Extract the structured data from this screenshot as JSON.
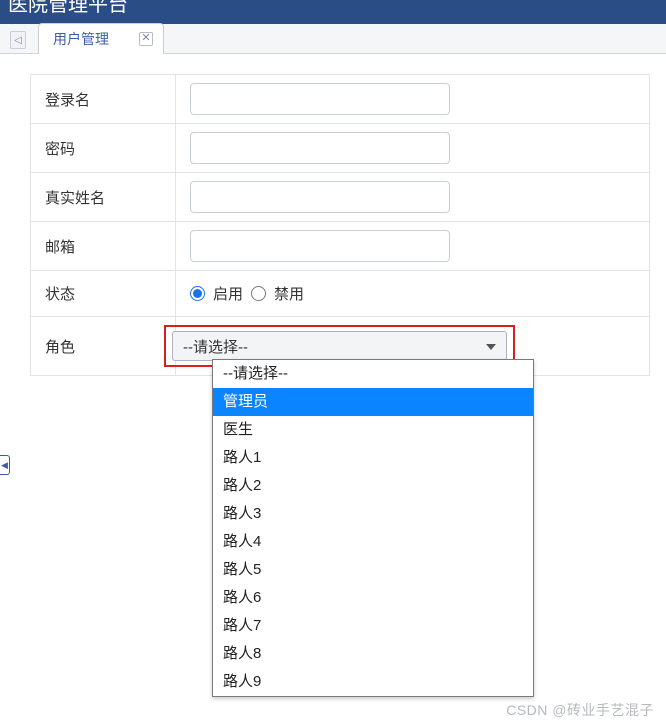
{
  "header": {
    "title_fragment": "医院管理平台"
  },
  "tabs": {
    "active": "用户管理"
  },
  "form": {
    "login_label": "登录名",
    "password_label": "密码",
    "realname_label": "真实姓名",
    "email_label": "邮箱",
    "status_label": "状态",
    "status_enable": "启用",
    "status_disable": "禁用",
    "role_label": "角色",
    "role_selected": "--请选择--"
  },
  "dropdown": {
    "items": [
      "--请选择--",
      "管理员",
      "医生",
      "路人1",
      "路人2",
      "路人3",
      "路人4",
      "路人5",
      "路人6",
      "路人7",
      "路人8",
      "路人9"
    ],
    "highlighted_index": 1
  },
  "watermark": "CSDN @砖业手艺混子"
}
